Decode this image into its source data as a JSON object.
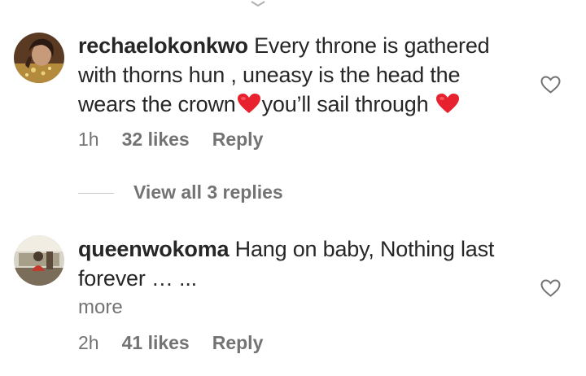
{
  "comments": [
    {
      "username": "rechaelokonkwo",
      "text_line1": "Every throne is gathered",
      "text_line2": "with thorns hun , uneasy is the head the",
      "text_line3a": "wears the crown",
      "text_line3b": "you’ll sail through",
      "time": "1h",
      "likes": "32 likes",
      "reply": "Reply",
      "view_replies": "View all 3 replies"
    },
    {
      "username": "queenwokoma",
      "text_line1": "Hang on baby, Nothing last",
      "text_line2": "forever … ...",
      "more": "more",
      "time": "2h",
      "likes": "41 likes",
      "reply": "Reply"
    }
  ],
  "icons": {
    "like": "heart-outline-icon",
    "emoji": "red-heart-emoji"
  },
  "colors": {
    "primary_text": "#262626",
    "secondary_text": "#737373",
    "heart_red": "#e8212e"
  }
}
